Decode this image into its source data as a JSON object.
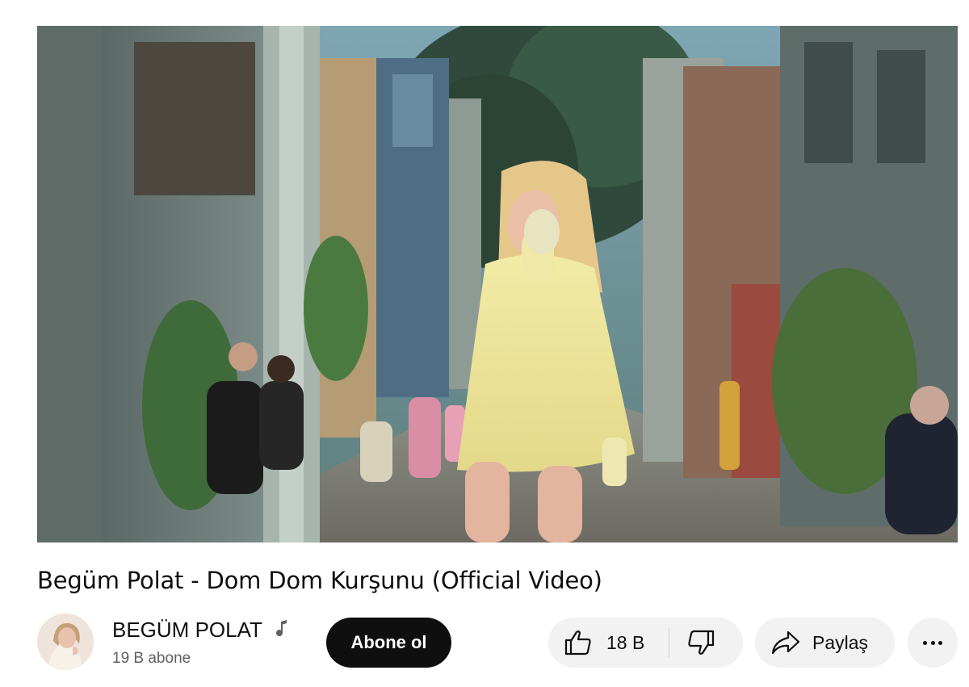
{
  "video": {
    "title": "Begüm Polat - Dom Dom Kurşunu (Official Video)"
  },
  "channel": {
    "name": "BEGÜM POLAT",
    "subscribers": "19 B abone",
    "verified_icon": "music-note-icon"
  },
  "actions": {
    "subscribe_label": "Abone ol",
    "like_count": "18 B",
    "share_label": "Paylaş",
    "like_icon": "thumbs-up-icon",
    "dislike_icon": "thumbs-down-icon",
    "share_icon": "share-arrow-icon",
    "more_icon": "more-horizontal-icon"
  },
  "colors": {
    "subscribe_bg": "#0f0f0f",
    "pill_bg": "#f2f2f2",
    "secondary_text": "#606060"
  }
}
